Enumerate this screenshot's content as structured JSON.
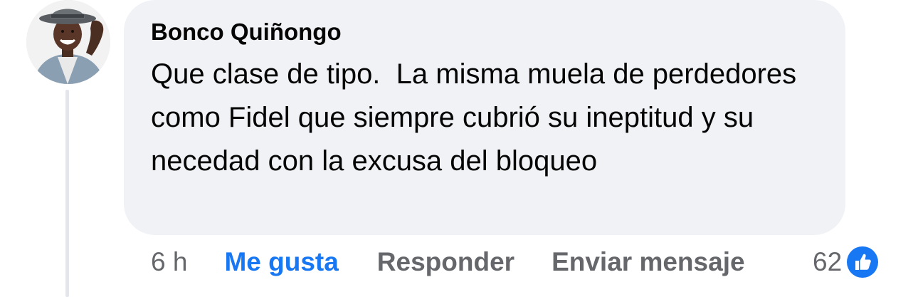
{
  "comment": {
    "author": "Bonco Quiñongo",
    "text": "Que clase de tipo.  La misma muela de perdedores como Fidel que siempre cubrió su ineptitud y su necedad con la excusa del bloqueo",
    "avatar_icon": "user-avatar-photo"
  },
  "actions": {
    "time": "6 h",
    "like": "Me gusta",
    "reply": "Responder",
    "send_message": "Enviar mensaje"
  },
  "reactions": {
    "count": "62",
    "icon": "like-thumb-icon"
  },
  "colors": {
    "bubble": "#f0f2f5",
    "text": "#050505",
    "muted": "#65676b",
    "accent": "#1877f2"
  }
}
